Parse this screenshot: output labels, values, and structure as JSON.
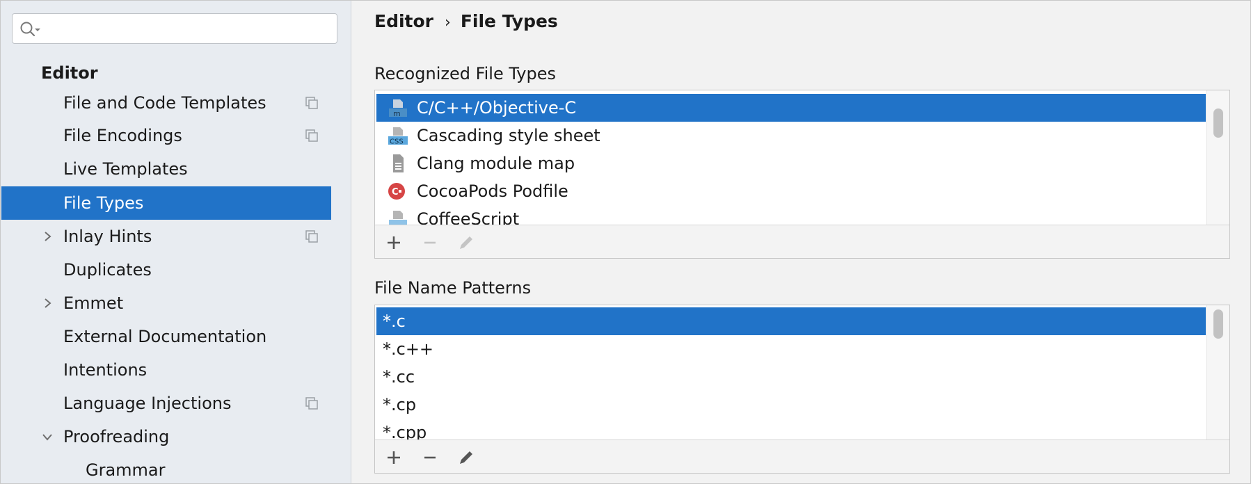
{
  "search": {
    "value": "",
    "placeholder": ""
  },
  "sidebar": {
    "group_header": "Editor",
    "items": [
      {
        "label": "File and Code Templates",
        "icon": "copy-icon"
      },
      {
        "label": "File Encodings",
        "icon": "copy-icon"
      },
      {
        "label": "Live Templates"
      },
      {
        "label": "File Types",
        "selected": true
      },
      {
        "label": "Inlay Hints",
        "expander": "chevron-right-icon",
        "icon": "copy-icon"
      },
      {
        "label": "Duplicates"
      },
      {
        "label": "Emmet",
        "expander": "chevron-right-icon"
      },
      {
        "label": "External Documentation"
      },
      {
        "label": "Intentions"
      },
      {
        "label": "Language Injections",
        "icon": "copy-icon"
      },
      {
        "label": "Proofreading",
        "expander": "chevron-down-icon"
      },
      {
        "label": "Grammar"
      }
    ]
  },
  "breadcrumb": {
    "parent": "Editor",
    "separator": "›",
    "current": "File Types"
  },
  "recognized": {
    "title": "Recognized File Types",
    "items": [
      {
        "label": "C/C++/Objective-C",
        "icon": "objc-file-icon",
        "selected": true
      },
      {
        "label": "Cascading style sheet",
        "icon": "css-file-icon"
      },
      {
        "label": "Clang module map",
        "icon": "text-file-icon"
      },
      {
        "label": "CocoaPods Podfile",
        "icon": "cocoapods-icon"
      },
      {
        "label": "CoffeeScript",
        "icon": "coffeescript-file-icon"
      }
    ],
    "toolbar": {
      "add": "plus-icon",
      "remove": "minus-icon",
      "edit": "pencil-icon",
      "remove_enabled": false,
      "edit_enabled": false
    }
  },
  "patterns": {
    "title": "File Name Patterns",
    "items": [
      {
        "label": "*.c",
        "selected": true
      },
      {
        "label": "*.c++"
      },
      {
        "label": "*.cc"
      },
      {
        "label": "*.cp"
      },
      {
        "label": "*.cpp"
      }
    ],
    "toolbar": {
      "add": "plus-icon",
      "remove": "minus-icon",
      "edit": "pencil-icon",
      "remove_enabled": true,
      "edit_enabled": true
    }
  },
  "colors": {
    "selection": "#2173c8",
    "sidebar_bg": "#e8ecf1",
    "panel_bg": "#f2f2f2"
  }
}
